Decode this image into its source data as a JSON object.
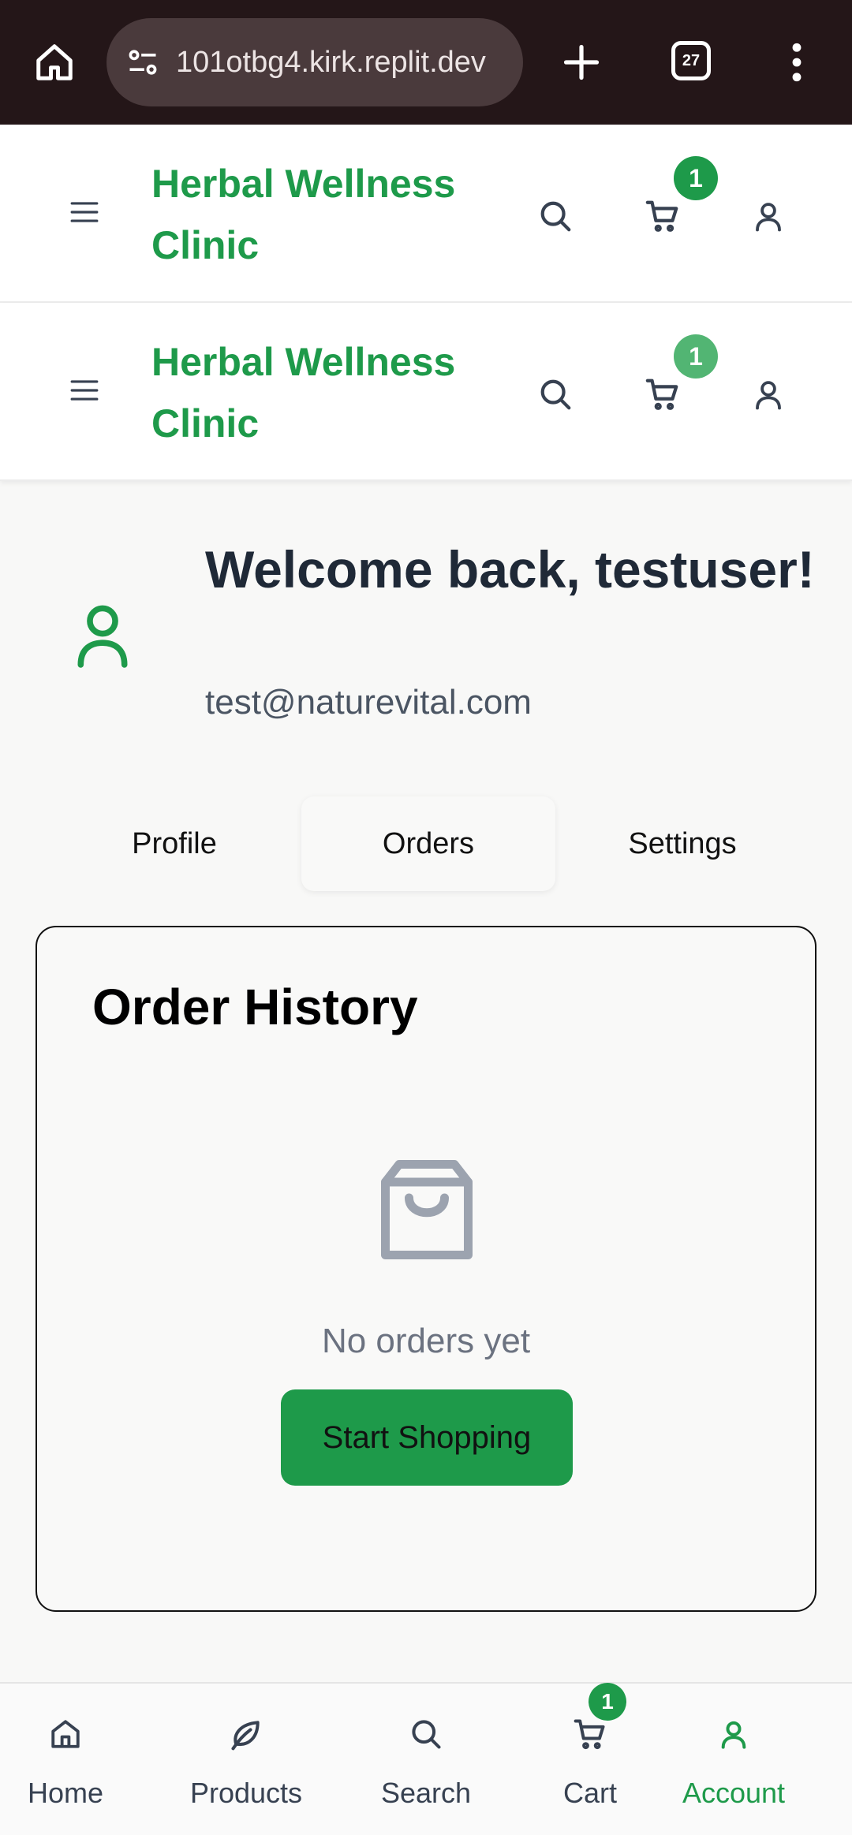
{
  "browser": {
    "url": "101otbg4.kirk.replit.dev",
    "tab_count": "27"
  },
  "header": {
    "brand": "Herbal Wellness Clinic",
    "cart_count": "1"
  },
  "welcome": {
    "title": "Welcome back, testuser!",
    "email": "test@naturevital.com"
  },
  "tabs": [
    {
      "label": "Profile"
    },
    {
      "label": "Orders"
    },
    {
      "label": "Settings"
    }
  ],
  "active_tab": "Orders",
  "orders": {
    "title": "Order History",
    "empty_text": "No orders yet",
    "cta_label": "Start Shopping"
  },
  "bottom_nav": {
    "items": [
      {
        "label": "Home",
        "icon": "home-icon"
      },
      {
        "label": "Products",
        "icon": "leaf-icon"
      },
      {
        "label": "Search",
        "icon": "search-icon"
      },
      {
        "label": "Cart",
        "icon": "cart-icon"
      },
      {
        "label": "Account",
        "icon": "user-icon"
      }
    ],
    "cart_count": "1",
    "active": "Account"
  },
  "colors": {
    "brand_green": "#1e9a4a",
    "browser_bg": "#241618",
    "text_dark": "#1f2937",
    "text_muted": "#6b7280"
  }
}
